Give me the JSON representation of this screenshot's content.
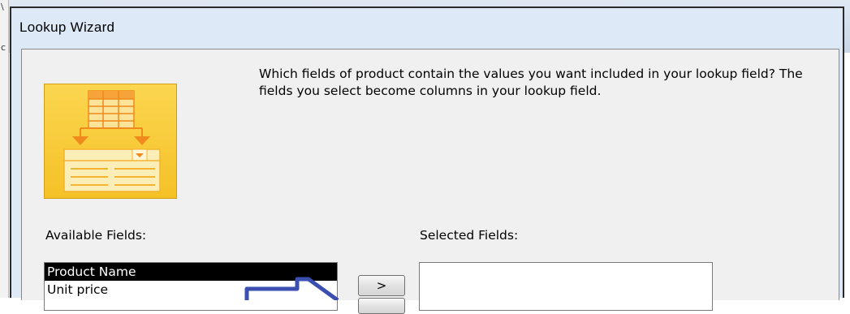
{
  "window": {
    "title": "Lookup Wizard"
  },
  "wizard": {
    "instruction": "Which fields of product contain the values you want included in your lookup field? The fields you select become columns in your lookup field.",
    "available_label": "Available Fields:",
    "selected_label": "Selected Fields:",
    "available_fields": [
      "Product Name",
      "Unit price"
    ],
    "selected_index": 0,
    "selected_fields": [],
    "add_button_label": ">"
  },
  "annotation": {
    "arrow_color": "#3a4fb0"
  },
  "colors": {
    "selection_bg": "#000000",
    "icon_yellow": "#f5c127",
    "icon_orange": "#f08a1c"
  }
}
